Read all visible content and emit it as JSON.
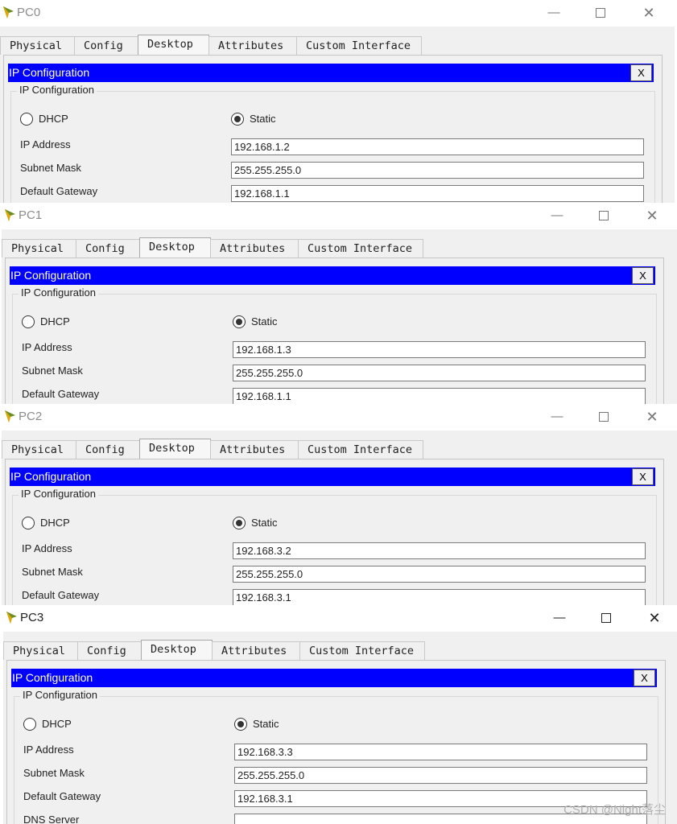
{
  "windows": [
    {
      "title": "PC0",
      "tabs": [
        "Physical",
        "Config",
        "Desktop",
        "Attributes",
        "Custom Interface"
      ],
      "active_tab": "Desktop",
      "ip_panel_title": "IP Configuration",
      "close_label": "X",
      "group_label": "IP Configuration",
      "dhcp_label": "DHCP",
      "static_label": "Static",
      "selected_mode": "Static",
      "ip_label": "IP Address",
      "ip_value": "192.168.1.2",
      "mask_label": "Subnet Mask",
      "mask_value": "255.255.255.0",
      "gw_label": "Default Gateway",
      "gw_value": "192.168.1.1"
    },
    {
      "title": "PC1",
      "tabs": [
        "Physical",
        "Config",
        "Desktop",
        "Attributes",
        "Custom Interface"
      ],
      "active_tab": "Desktop",
      "ip_panel_title": "IP Configuration",
      "close_label": "X",
      "group_label": "IP Configuration",
      "dhcp_label": "DHCP",
      "static_label": "Static",
      "selected_mode": "Static",
      "ip_label": "IP Address",
      "ip_value": "192.168.1.3",
      "mask_label": "Subnet Mask",
      "mask_value": "255.255.255.0",
      "gw_label": "Default Gateway",
      "gw_value": "192.168.1.1"
    },
    {
      "title": "PC2",
      "tabs": [
        "Physical",
        "Config",
        "Desktop",
        "Attributes",
        "Custom Interface"
      ],
      "active_tab": "Desktop",
      "ip_panel_title": "IP Configuration",
      "close_label": "X",
      "group_label": "IP Configuration",
      "dhcp_label": "DHCP",
      "static_label": "Static",
      "selected_mode": "Static",
      "ip_label": "IP Address",
      "ip_value": "192.168.3.2",
      "mask_label": "Subnet Mask",
      "mask_value": "255.255.255.0",
      "gw_label": "Default Gateway",
      "gw_value": "192.168.3.1"
    },
    {
      "title": "PC3",
      "tabs": [
        "Physical",
        "Config",
        "Desktop",
        "Attributes",
        "Custom Interface"
      ],
      "active_tab": "Desktop",
      "ip_panel_title": "IP Configuration",
      "close_label": "X",
      "group_label": "IP Configuration",
      "dhcp_label": "DHCP",
      "static_label": "Static",
      "selected_mode": "Static",
      "ip_label": "IP Address",
      "ip_value": "192.168.3.3",
      "mask_label": "Subnet Mask",
      "mask_value": "255.255.255.0",
      "gw_label": "Default Gateway",
      "gw_value": "192.168.3.1",
      "dns_label": "DNS Server",
      "dns_value": ""
    }
  ],
  "watermark": "CSDN @Night落尘",
  "colors": {
    "ip_bar": "#0000ff",
    "window_bg": "#f0f0f0"
  }
}
